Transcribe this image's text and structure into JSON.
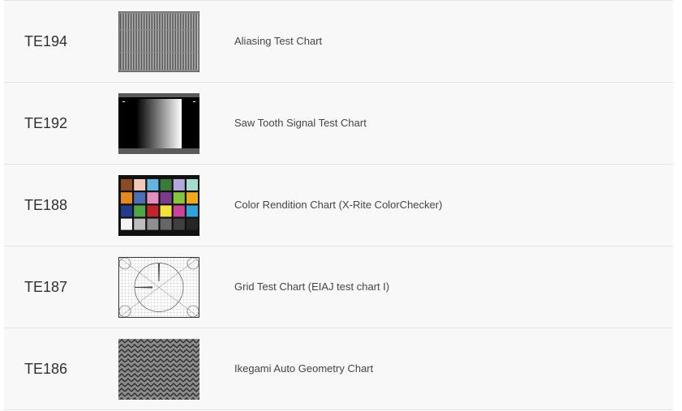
{
  "rows": [
    {
      "code": "TE194",
      "name": "Aliasing Test Chart",
      "thumb": "aliasing-chart-image"
    },
    {
      "code": "TE192",
      "name": "Saw Tooth Signal Test Chart",
      "thumb": "sawtooth-chart-image"
    },
    {
      "code": "TE188",
      "name": "Color Rendition Chart (X-Rite ColorChecker)",
      "thumb": "colorchecker-chart-image"
    },
    {
      "code": "TE187",
      "name": "Grid Test Chart (EIAJ test chart I)",
      "thumb": "grid-chart-image"
    },
    {
      "code": "TE186",
      "name": "Ikegami Auto Geometry Chart",
      "thumb": "geometry-chart-image"
    }
  ],
  "colorchecker_swatches": [
    "#8a4b22",
    "#f1c9b8",
    "#63b4e0",
    "#3b7a3a",
    "#b5a7d9",
    "#a6dccf",
    "#e48a1d",
    "#4f6fb5",
    "#e08fc0",
    "#7a3d8d",
    "#86c33f",
    "#f0a81e",
    "#233c8d",
    "#4fa646",
    "#c2242b",
    "#f2e23c",
    "#c9429b",
    "#2fa2d9",
    "#f3f3f3",
    "#bdbdbd",
    "#8f8f8f",
    "#666666",
    "#3f3f3f",
    "#262626"
  ]
}
